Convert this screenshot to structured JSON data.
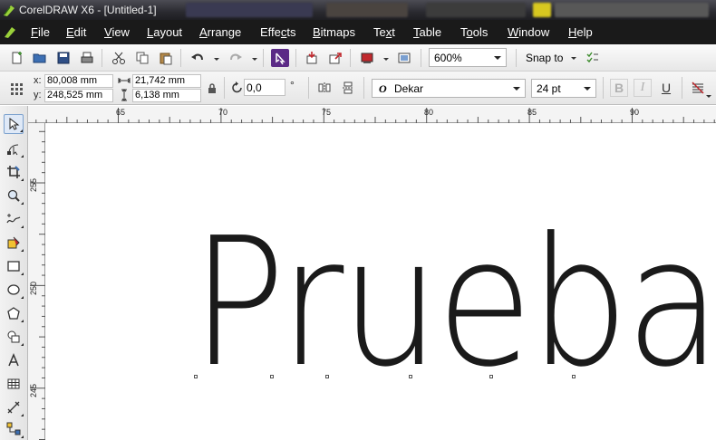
{
  "window": {
    "title": "CorelDRAW X6 - [Untitled-1]"
  },
  "menu": [
    {
      "pre": "",
      "u": "F",
      "post": "ile"
    },
    {
      "pre": "",
      "u": "E",
      "post": "dit"
    },
    {
      "pre": "",
      "u": "V",
      "post": "iew"
    },
    {
      "pre": "",
      "u": "L",
      "post": "ayout"
    },
    {
      "pre": "",
      "u": "A",
      "post": "rrange"
    },
    {
      "pre": "Effe",
      "u": "c",
      "post": "ts"
    },
    {
      "pre": "",
      "u": "B",
      "post": "itmaps"
    },
    {
      "pre": "Te",
      "u": "x",
      "post": "t"
    },
    {
      "pre": "",
      "u": "T",
      "post": "able"
    },
    {
      "pre": "T",
      "u": "o",
      "post": "ols"
    },
    {
      "pre": "",
      "u": "W",
      "post": "indow"
    },
    {
      "pre": "",
      "u": "H",
      "post": "elp"
    }
  ],
  "toolbar": {
    "zoom": "600%",
    "snap_to": "Snap to"
  },
  "property_bar": {
    "x_label": "x:",
    "x_value": "80,008 mm",
    "y_label": "y:",
    "y_value": "248,525 mm",
    "width": "21,742 mm",
    "height": "6,138 mm",
    "rotation": "0,0",
    "degree_symbol": "°",
    "font_name": "Dekar",
    "font_size": "24 pt",
    "font_style_glyph": "O",
    "bold_glyph": "B",
    "italic_glyph": "I",
    "underline_glyph": "U"
  },
  "rulers": {
    "horizontal": [
      "65",
      "70",
      "75",
      "80",
      "85",
      "90"
    ],
    "vertical": [
      "255",
      "250",
      "245"
    ]
  },
  "canvas": {
    "text": "Prueba"
  },
  "colors": {
    "titlebar": "#2a2a30",
    "menubar": "#1a1a1a",
    "text_fill": "#1a1a1a",
    "accent_purple": "#5b2a86",
    "accent_red": "#c0282d"
  }
}
